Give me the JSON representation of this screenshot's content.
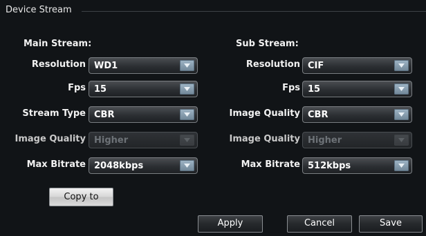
{
  "group_title": "Device Stream",
  "main": {
    "title": "Main Stream:",
    "rows": [
      {
        "label": "Resolution",
        "value": "WD1",
        "enabled": true
      },
      {
        "label": "Fps",
        "value": "15",
        "enabled": true
      },
      {
        "label": "Stream Type",
        "value": "CBR",
        "enabled": true
      },
      {
        "label": "Image Quality",
        "value": "Higher",
        "enabled": false
      },
      {
        "label": "Max Bitrate",
        "value": "2048kbps",
        "enabled": true
      }
    ]
  },
  "sub": {
    "title": "Sub Stream:",
    "rows": [
      {
        "label": "Resolution",
        "value": "CIF",
        "enabled": true
      },
      {
        "label": "Fps",
        "value": "15",
        "enabled": true
      },
      {
        "label": "Image Quality",
        "value": "CBR",
        "enabled": true
      },
      {
        "label": "Image Quality",
        "value": "Higher",
        "enabled": false
      },
      {
        "label": "Max Bitrate",
        "value": "512kbps",
        "enabled": true
      }
    ]
  },
  "buttons": {
    "copy_to": "Copy to",
    "apply": "Apply",
    "cancel": "Cancel",
    "save": "Save"
  },
  "icons": {
    "dropdown": "chevron-down-icon"
  }
}
